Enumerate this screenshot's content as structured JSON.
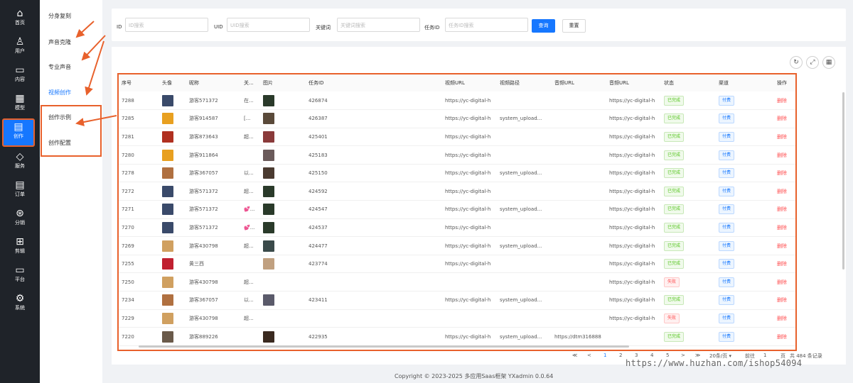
{
  "rail": [
    {
      "label": "首页",
      "icon": "home-icon",
      "glyph": "⌂"
    },
    {
      "label": "用户",
      "icon": "user-icon",
      "glyph": "♙"
    },
    {
      "label": "内容",
      "icon": "folder-icon",
      "glyph": "▭"
    },
    {
      "label": "模型",
      "icon": "grid-icon",
      "glyph": "▦"
    },
    {
      "label": "创作",
      "icon": "create-doc-icon",
      "glyph": "▤"
    },
    {
      "label": "服务",
      "icon": "diamond-icon",
      "glyph": "◇"
    },
    {
      "label": "订单",
      "icon": "order-icon",
      "glyph": "▤"
    },
    {
      "label": "分销",
      "icon": "share-icon",
      "glyph": "⊛"
    },
    {
      "label": "剪辑",
      "icon": "edit-grid-icon",
      "glyph": "⊞"
    },
    {
      "label": "平台",
      "icon": "monitor-icon",
      "glyph": "▭"
    },
    {
      "label": "系统",
      "icon": "gear-icon",
      "glyph": "⚙"
    }
  ],
  "submenu": [
    "分身复刻",
    "声音克隆",
    "专业声音",
    "视频创作",
    "创作示例",
    "创作配置"
  ],
  "search": {
    "id_label": "ID",
    "id_placeholder": "ID搜索",
    "uid_label": "UID",
    "uid_placeholder": "UID搜索",
    "kw_label": "关键词",
    "kw_placeholder": "关键词搜索",
    "task_label": "任务ID",
    "task_placeholder": "任务ID搜索",
    "query": "查询",
    "reset": "重置"
  },
  "tools": [
    "refresh-icon",
    "fullscreen-icon",
    "columns-icon"
  ],
  "tool_glyphs": [
    "↻",
    "⤢",
    "▦"
  ],
  "columns": [
    "序号",
    "头像",
    "昵称",
    "关...",
    "图片",
    "任务ID",
    "视频URL",
    "视频路径",
    "音频URL",
    "音频URL",
    "状态",
    "渠道",
    "操作"
  ],
  "rows": [
    {
      "no": "7288",
      "av": "#3a4a6a",
      "nick": "游客571372",
      "kw": "在...",
      "pic": "#2a3a2a",
      "task": "426874",
      "vurl": "https://yc-digital-h",
      "vpath": "",
      "aurl1": "",
      "aurl2": "https://yc-digital-h",
      "status": "已完成",
      "ok": true,
      "channel": "付费",
      "op": "删除"
    },
    {
      "no": "7285",
      "av": "#e8a020",
      "nick": "游客914587",
      "kw": "[...",
      "pic": "#5a4a3a",
      "task": "426387",
      "vurl": "https://yc-digital-h",
      "vpath": "system_upload...",
      "aurl1": "",
      "aurl2": "https://yc-digital-h",
      "status": "已完成",
      "ok": true,
      "channel": "付费",
      "op": "删除"
    },
    {
      "no": "7281",
      "av": "#b03020",
      "nick": "游客873643",
      "kw": "超...",
      "pic": "#8a3a3a",
      "task": "425401",
      "vurl": "https://yc-digital-h",
      "vpath": "",
      "aurl1": "",
      "aurl2": "https://yc-digital-h",
      "status": "已完成",
      "ok": true,
      "channel": "付费",
      "op": "删除"
    },
    {
      "no": "7280",
      "av": "#e8a020",
      "nick": "游客911864",
      "kw": "",
      "pic": "#6a5a5a",
      "task": "425183",
      "vurl": "https://yc-digital-h",
      "vpath": "",
      "aurl1": "",
      "aurl2": "https://yc-digital-h",
      "status": "已完成",
      "ok": true,
      "channel": "付费",
      "op": "删除"
    },
    {
      "no": "7278",
      "av": "#b07040",
      "nick": "游客367057",
      "kw": "以...",
      "pic": "#4a3a30",
      "task": "425150",
      "vurl": "https://yc-digital-h",
      "vpath": "system_upload...",
      "aurl1": "",
      "aurl2": "https://yc-digital-h",
      "status": "已完成",
      "ok": true,
      "channel": "付费",
      "op": "删除"
    },
    {
      "no": "7272",
      "av": "#3a4a6a",
      "nick": "游客571372",
      "kw": "超...",
      "pic": "#2a3a2a",
      "task": "424592",
      "vurl": "https://yc-digital-h",
      "vpath": "",
      "aurl1": "",
      "aurl2": "https://yc-digital-h",
      "status": "已完成",
      "ok": true,
      "channel": "付费",
      "op": "删除"
    },
    {
      "no": "7271",
      "av": "#3a4a6a",
      "nick": "游客571372",
      "kw": "💕...",
      "pic": "#2a3a2a",
      "task": "424547",
      "vurl": "https://yc-digital-h",
      "vpath": "system_upload...",
      "aurl1": "",
      "aurl2": "https://yc-digital-h",
      "status": "已完成",
      "ok": true,
      "channel": "付费",
      "op": "删除"
    },
    {
      "no": "7270",
      "av": "#3a4a6a",
      "nick": "游客571372",
      "kw": "💕...",
      "pic": "#2a3a2a",
      "task": "424537",
      "vurl": "https://yc-digital-h",
      "vpath": "",
      "aurl1": "",
      "aurl2": "https://yc-digital-h",
      "status": "已完成",
      "ok": true,
      "channel": "付费",
      "op": "删除"
    },
    {
      "no": "7269",
      "av": "#d0a060",
      "nick": "游客430798",
      "kw": "超...",
      "pic": "#3a4a4a",
      "task": "424477",
      "vurl": "https://yc-digital-h",
      "vpath": "system_upload...",
      "aurl1": "",
      "aurl2": "https://yc-digital-h",
      "status": "已完成",
      "ok": true,
      "channel": "付费",
      "op": "删除"
    },
    {
      "no": "7255",
      "av": "#c02030",
      "nick": "黄三西",
      "kw": "",
      "pic": "#c0a080",
      "task": "423774",
      "vurl": "https://yc-digital-h",
      "vpath": "",
      "aurl1": "",
      "aurl2": "https://yc-digital-h",
      "status": "已完成",
      "ok": true,
      "channel": "付费",
      "op": "删除"
    },
    {
      "no": "7250",
      "av": "#d0a060",
      "nick": "游客430798",
      "kw": "超...",
      "pic": "",
      "task": "",
      "vurl": "",
      "vpath": "",
      "aurl1": "",
      "aurl2": "https://yc-digital-h",
      "status": "失败",
      "ok": false,
      "channel": "付费",
      "op": "删除"
    },
    {
      "no": "7234",
      "av": "#b07040",
      "nick": "游客367057",
      "kw": "以...",
      "pic": "#5a5a6a",
      "task": "423411",
      "vurl": "https://yc-digital-h",
      "vpath": "system_upload...",
      "aurl1": "",
      "aurl2": "https://yc-digital-h",
      "status": "已完成",
      "ok": true,
      "channel": "付费",
      "op": "删除"
    },
    {
      "no": "7229",
      "av": "#d0a060",
      "nick": "游客430798",
      "kw": "超...",
      "pic": "",
      "task": "",
      "vurl": "",
      "vpath": "",
      "aurl1": "",
      "aurl2": "https://yc-digital-h",
      "status": "失败",
      "ok": false,
      "channel": "付费",
      "op": "删除"
    },
    {
      "no": "7220",
      "av": "#6a5a4a",
      "nick": "游客889226",
      "kw": "",
      "pic": "#3a2a20",
      "task": "422935",
      "vurl": "https://yc-digital-h",
      "vpath": "system_upload...",
      "aurl1": "https://dtm316888",
      "aurl2": "",
      "status": "已完成",
      "ok": true,
      "channel": "付费",
      "op": "删除"
    }
  ],
  "pager": {
    "prev2": "≪",
    "prev": "<",
    "pages": [
      "1",
      "2",
      "3",
      "4",
      "5"
    ],
    "next": ">",
    "next2": "≫",
    "size": "20条/页 ▾",
    "goto": "前往",
    "page": "1",
    "unit": "页",
    "total": "共 484 条记录"
  },
  "footer": "Copyright © 2023-2025 多应用Saas框架 YXadmin 0.0.64",
  "watermark": "https://www.huzhan.com/ishop54094",
  "colors": {
    "accent": "#1677ff",
    "annotation": "#e8612c",
    "rail": "#1f2329",
    "success": "#52c41a",
    "danger": "#ff4d4f"
  }
}
